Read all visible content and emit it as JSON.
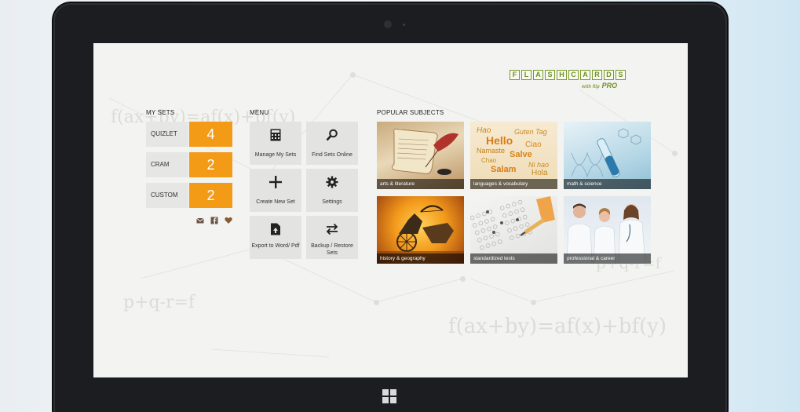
{
  "logo": {
    "letters": [
      "F",
      "L",
      "A",
      "S",
      "H",
      "C",
      "A",
      "R",
      "D",
      "S"
    ],
    "subtitle": "PRO",
    "tagline": "with flip"
  },
  "my_sets": {
    "title": "MY SETS",
    "items": [
      {
        "name": "QUIZLET",
        "count": "4"
      },
      {
        "name": "CRAM",
        "count": "2"
      },
      {
        "name": "CUSTOM",
        "count": "2"
      }
    ]
  },
  "menu": {
    "title": "MENU",
    "items": [
      {
        "label": "Manage My Sets",
        "icon": "calculator-icon"
      },
      {
        "label": "Find Sets Online",
        "icon": "search-icon"
      },
      {
        "label": "Create New Set",
        "icon": "plus-icon"
      },
      {
        "label": "Settings",
        "icon": "gear-icon"
      },
      {
        "label": "Export to Word/ Pdf",
        "icon": "export-document-icon"
      },
      {
        "label": "Backup / Restore Sets",
        "icon": "swap-arrows-icon"
      }
    ]
  },
  "subjects": {
    "title": "POPULAR SUBJECTS",
    "items": [
      {
        "label": "arts & literature"
      },
      {
        "label": "languages & vocabulary"
      },
      {
        "label": "math & science"
      },
      {
        "label": "history & geography"
      },
      {
        "label": "standardized tests"
      },
      {
        "label": "professional & career"
      }
    ]
  },
  "languages_words": [
    "Hao",
    "Hello",
    "Guten Tag",
    "Ciao",
    "Namaste",
    "Salve",
    "Chao",
    "Ni hao",
    "Salam",
    "Hola"
  ],
  "background_formulas": [
    "f(ax+by)=af(x)+bf(y)",
    "f(ax+by)=af(x)+bf(y)",
    "p+q-r=f",
    "p+q-r=f"
  ],
  "colors": {
    "accent": "#f39b17",
    "logo_green": "#6f8f22",
    "tile": "#e3e3e1",
    "screen_bg": "#f3f3f1"
  },
  "icons": {
    "mail": "mail-icon",
    "facebook": "facebook-icon",
    "heart": "heart-icon",
    "windows": "windows-logo-icon"
  }
}
